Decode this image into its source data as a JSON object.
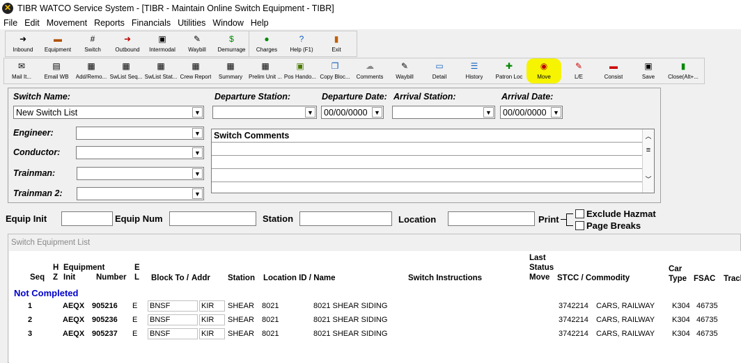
{
  "window": {
    "title": "TIBR WATCO Service System - [TIBR - Maintain Online Switch Equipment - TIBR]"
  },
  "menu": [
    "File",
    "Edit",
    "Movement",
    "Reports",
    "Financials",
    "Utilities",
    "Window",
    "Help"
  ],
  "toolbar_main": [
    {
      "label": "Inbound",
      "icon": "inbound-icon"
    },
    {
      "label": "Equipment",
      "icon": "equipment-icon"
    },
    {
      "label": "Switch",
      "icon": "switch-icon"
    },
    {
      "label": "Outbound",
      "icon": "outbound-icon"
    },
    {
      "label": "Intermodal",
      "icon": "intermodal-icon"
    },
    {
      "label": "Waybill",
      "icon": "waybill-icon"
    },
    {
      "label": "Demurrage",
      "icon": "demurrage-icon"
    },
    {
      "label": "Charges",
      "icon": "charges-icon"
    },
    {
      "label": "Help (F1)",
      "icon": "help-icon"
    },
    {
      "label": "Exit",
      "icon": "exit-icon"
    }
  ],
  "toolbar_switch": [
    {
      "label": "Mail It...",
      "icon": "mail-icon"
    },
    {
      "label": "Email WB",
      "icon": "email-icon"
    },
    {
      "label": "Add/Remo...",
      "icon": "add-remove-icon"
    },
    {
      "label": "SwList Seq...",
      "icon": "swlist-seq-icon"
    },
    {
      "label": "SwList Stat...",
      "icon": "swlist-stat-icon"
    },
    {
      "label": "Crew Report",
      "icon": "crew-report-icon"
    },
    {
      "label": "Summary",
      "icon": "summary-icon"
    },
    {
      "label": "Prelim Unit ...",
      "icon": "prelim-unit-icon"
    },
    {
      "label": "Pos Hando...",
      "icon": "pos-handoff-icon"
    },
    {
      "label": "Copy Bloc...",
      "icon": "copy-block-icon"
    },
    {
      "label": "Comments",
      "icon": "comments-icon"
    },
    {
      "label": "Waybill",
      "icon": "waybill-icon"
    },
    {
      "label": "Detail",
      "icon": "detail-icon"
    },
    {
      "label": "History",
      "icon": "history-icon"
    },
    {
      "label": "Patron Loc",
      "icon": "patron-loc-icon"
    },
    {
      "label": "Move",
      "icon": "move-icon"
    },
    {
      "label": "L/E",
      "icon": "le-icon"
    },
    {
      "label": "Consist",
      "icon": "consist-icon"
    },
    {
      "label": "Save",
      "icon": "save-icon"
    },
    {
      "label": "Close(Alt+...",
      "icon": "close-icon"
    }
  ],
  "form": {
    "switch_name_label": "Switch Name:",
    "switch_name_value": "New Switch List",
    "departure_station_label": "Departure Station:",
    "departure_date_label": "Departure Date:",
    "departure_date_value": "00/00/0000",
    "arrival_station_label": "Arrival Station:",
    "arrival_date_label": "Arrival Date:",
    "arrival_date_value": "00/00/0000",
    "engineer_label": "Engineer:",
    "conductor_label": "Conductor:",
    "trainman_label": "Trainman:",
    "trainman2_label": "Trainman 2:",
    "comments_label": "Switch Comments"
  },
  "search": {
    "equip_init_label": "Equip Init",
    "equip_num_label": "Equip Num",
    "station_label": "Station",
    "location_label": "Location",
    "print_label": "Print",
    "exclude_hazmat_label": "Exclude Hazmat",
    "page_breaks_label": "Page Breaks"
  },
  "list": {
    "title": "Switch Equipment List",
    "headers": {
      "seq": "Seq",
      "hz": "H\nZ",
      "equipment": "Equipment",
      "init": "Init",
      "number": "Number",
      "el": "E\nL",
      "block_to": "Block To /",
      "addr": "Addr",
      "station": "Station",
      "location": "Location ID / Name",
      "instructions": "Switch Instructions",
      "last_status_move": "Last\nStatus\nMove",
      "stcc": "STCC / Commodity",
      "car_type": "Car\nType",
      "fsac": "FSAC",
      "track": "Track"
    },
    "group_label": "Not Completed",
    "rows": [
      {
        "seq": "1",
        "init": "AEQX",
        "number": "905216",
        "el": "E",
        "block": "BNSF",
        "addr": "KIR",
        "station": "SHEAR",
        "loc_id": "8021",
        "loc_name": "8021 SHEAR SIDING",
        "stcc": "3742214",
        "commodity": "CARS, RAILWAY",
        "car_type": "K304",
        "fsac": "46735"
      },
      {
        "seq": "2",
        "init": "AEQX",
        "number": "905236",
        "el": "E",
        "block": "BNSF",
        "addr": "KIR",
        "station": "SHEAR",
        "loc_id": "8021",
        "loc_name": "8021 SHEAR SIDING",
        "stcc": "3742214",
        "commodity": "CARS, RAILWAY",
        "car_type": "K304",
        "fsac": "46735"
      },
      {
        "seq": "3",
        "init": "AEQX",
        "number": "905237",
        "el": "E",
        "block": "BNSF",
        "addr": "KIR",
        "station": "SHEAR",
        "loc_id": "8021",
        "loc_name": "8021 SHEAR SIDING",
        "stcc": "3742214",
        "commodity": "CARS, RAILWAY",
        "car_type": "K304",
        "fsac": "46735"
      }
    ]
  },
  "colors": {
    "highlight": "#f6f400",
    "group_label": "#0000cc"
  }
}
